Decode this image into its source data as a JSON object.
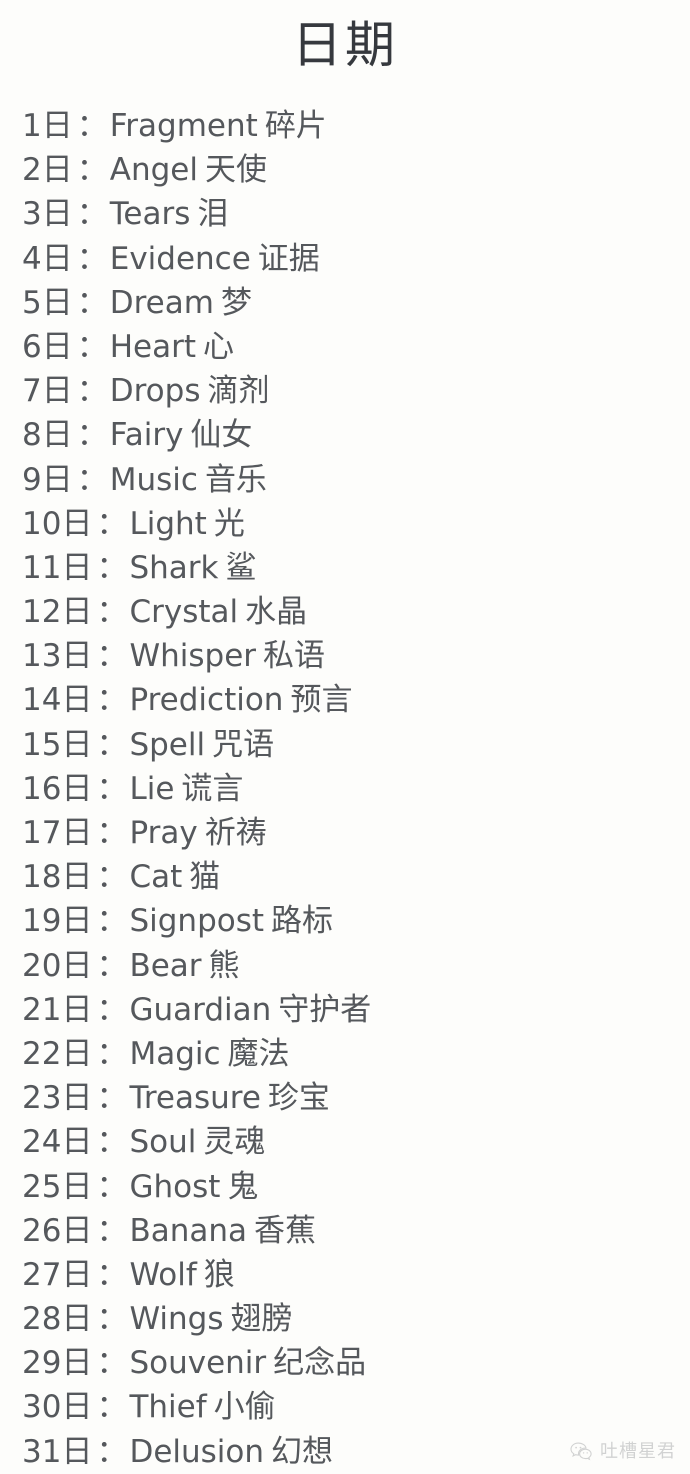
{
  "page": {
    "title": "日期",
    "background_color": "#fdfdfb",
    "text_color": "#55585c",
    "title_color": "#36393e"
  },
  "list": {
    "day_unit": "日",
    "separator": "：",
    "items": [
      {
        "day": "1",
        "unit": "日",
        "sep": "：",
        "en": "Fragment",
        "zh": "碎片"
      },
      {
        "day": "2",
        "unit": "日",
        "sep": "：",
        "en": "Angel",
        "zh": "天使"
      },
      {
        "day": "3",
        "unit": "日",
        "sep": "：",
        "en": "Tears",
        "zh": "泪"
      },
      {
        "day": "4",
        "unit": "日",
        "sep": "：",
        "en": "Evidence",
        "zh": "证据"
      },
      {
        "day": "5",
        "unit": "日",
        "sep": "：",
        "en": "Dream",
        "zh": "梦"
      },
      {
        "day": "6",
        "unit": "日",
        "sep": "：",
        "en": "Heart",
        "zh": "心"
      },
      {
        "day": "7",
        "unit": "日",
        "sep": "：",
        "en": "Drops",
        "zh": "滴剂"
      },
      {
        "day": "8",
        "unit": "日",
        "sep": "：",
        "en": "Fairy",
        "zh": "仙女"
      },
      {
        "day": "9",
        "unit": "日",
        "sep": "：",
        "en": "Music",
        "zh": "音乐"
      },
      {
        "day": "10",
        "unit": "日",
        "sep": "：",
        "en": "Light",
        "zh": "光"
      },
      {
        "day": "11",
        "unit": "日",
        "sep": "：",
        "en": "Shark",
        "zh": "鲨"
      },
      {
        "day": "12",
        "unit": "日",
        "sep": "：",
        "en": "Crystal",
        "zh": "水晶"
      },
      {
        "day": "13",
        "unit": "日",
        "sep": "：",
        "en": "Whisper",
        "zh": "私语"
      },
      {
        "day": "14",
        "unit": "日",
        "sep": "：",
        "en": "Prediction",
        "zh": "预言"
      },
      {
        "day": "15",
        "unit": "日",
        "sep": "：",
        "en": "Spell",
        "zh": "咒语"
      },
      {
        "day": "16",
        "unit": "日",
        "sep": "：",
        "en": "Lie",
        "zh": "谎言"
      },
      {
        "day": "17",
        "unit": "日",
        "sep": "：",
        "en": "Pray",
        "zh": "祈祷"
      },
      {
        "day": "18",
        "unit": "日",
        "sep": "：",
        "en": "Cat",
        "zh": "猫"
      },
      {
        "day": "19",
        "unit": "日",
        "sep": "：",
        "en": "Signpost",
        "zh": "路标"
      },
      {
        "day": "20",
        "unit": "日",
        "sep": "：",
        "en": "Bear",
        "zh": "熊"
      },
      {
        "day": "21",
        "unit": "日",
        "sep": "：",
        "en": "Guardian",
        "zh": "守护者"
      },
      {
        "day": "22",
        "unit": "日",
        "sep": "：",
        "en": "Magic",
        "zh": "魔法"
      },
      {
        "day": "23",
        "unit": "日",
        "sep": "：",
        "en": "Treasure",
        "zh": "珍宝"
      },
      {
        "day": "24",
        "unit": "日",
        "sep": "：",
        "en": "Soul",
        "zh": "灵魂"
      },
      {
        "day": "25",
        "unit": "日",
        "sep": "：",
        "en": "Ghost",
        "zh": "鬼"
      },
      {
        "day": "26",
        "unit": "日",
        "sep": "：",
        "en": "Banana",
        "zh": "香蕉"
      },
      {
        "day": "27",
        "unit": "日",
        "sep": "：",
        "en": "Wolf",
        "zh": "狼"
      },
      {
        "day": "28",
        "unit": "日",
        "sep": "：",
        "en": "Wings",
        "zh": "翅膀"
      },
      {
        "day": "29",
        "unit": "日",
        "sep": "：",
        "en": "Souvenir",
        "zh": "纪念品"
      },
      {
        "day": "30",
        "unit": "日",
        "sep": "：",
        "en": "Thief",
        "zh": "小偷"
      },
      {
        "day": "31",
        "unit": "日",
        "sep": "：",
        "en": "Delusion",
        "zh": "幻想"
      }
    ]
  },
  "watermark": {
    "icon": "wechat-icon",
    "label": "吐槽星君"
  }
}
